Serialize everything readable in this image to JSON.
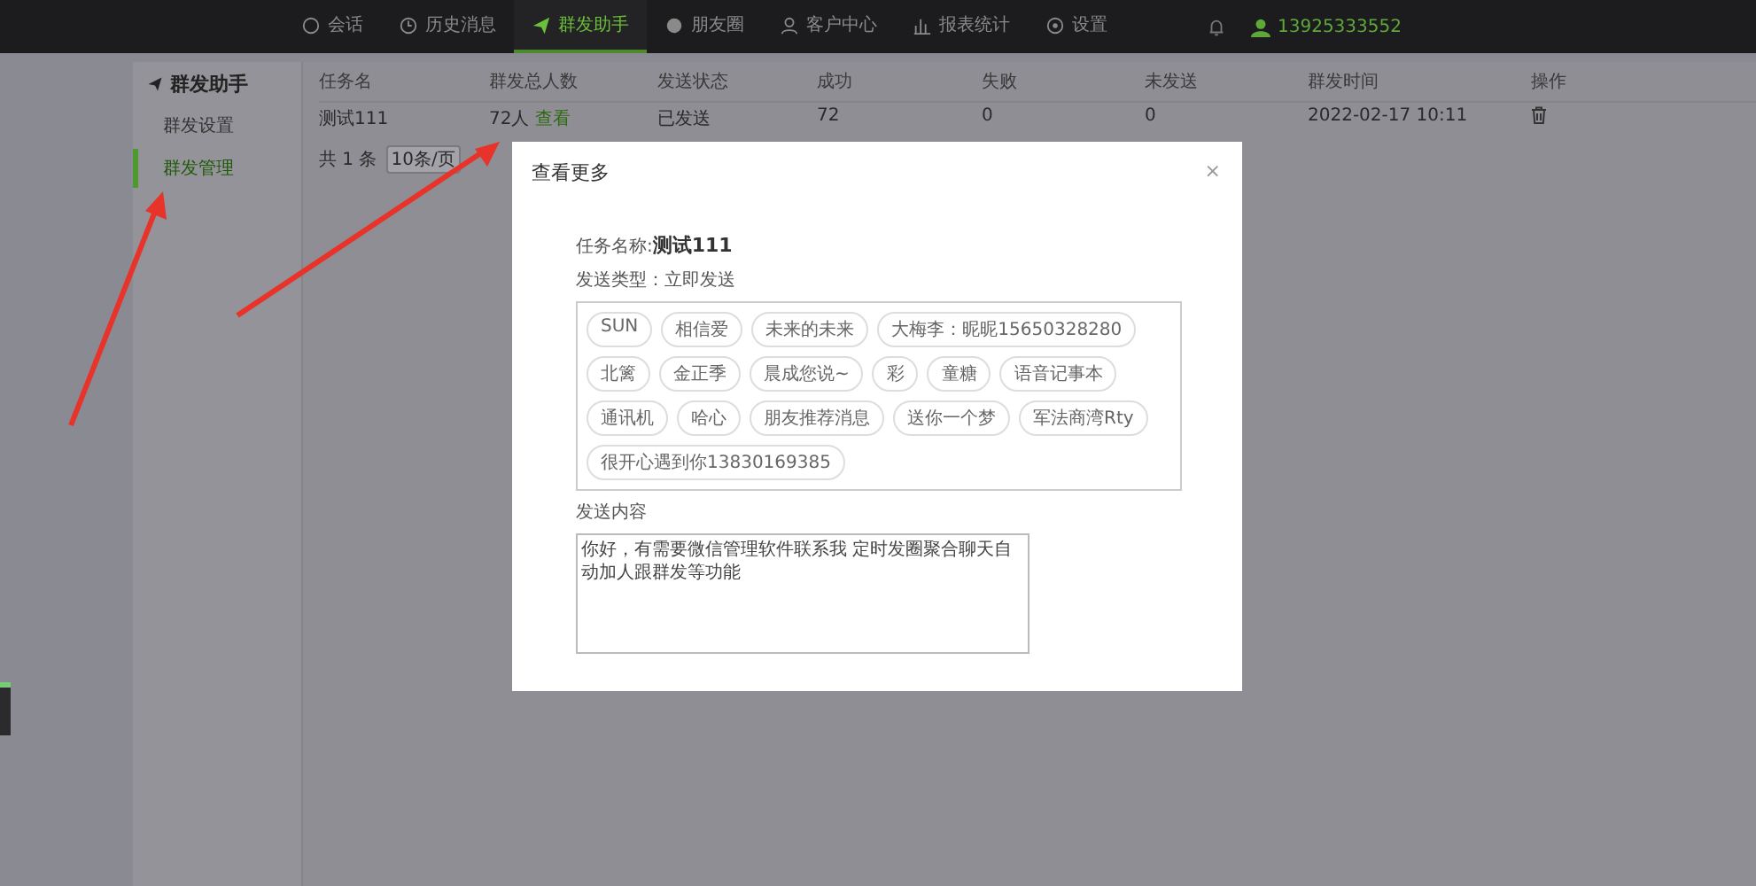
{
  "nav": {
    "items": [
      {
        "label": "会话",
        "selected": false
      },
      {
        "label": "历史消息",
        "selected": false
      },
      {
        "label": "群发助手",
        "selected": true
      },
      {
        "label": "朋友圈",
        "selected": false
      },
      {
        "label": "客户中心",
        "selected": false
      },
      {
        "label": "报表统计",
        "selected": false
      },
      {
        "label": "设置",
        "selected": false
      }
    ],
    "user": "13925333552"
  },
  "sidebar": {
    "title": "群发助手",
    "items": [
      {
        "label": "群发设置",
        "selected": false
      },
      {
        "label": "群发管理",
        "selected": true
      }
    ]
  },
  "table": {
    "columns": [
      "任务名",
      "群发总人数",
      "发送状态",
      "成功",
      "失败",
      "未发送",
      "群发时间",
      "操作"
    ],
    "rows": [
      {
        "name": "测试111",
        "count": "72人",
        "view_link": "查看",
        "status": "已发送",
        "success": "72",
        "failed": "0",
        "unsent": "0",
        "time": "2022-02-17 10:11"
      }
    ]
  },
  "pagination": {
    "total": "共 1 条",
    "page_size": "10条/页"
  },
  "modal": {
    "title": "查看更多",
    "close": "×",
    "task_label": "任务名称:",
    "task_name": "测试111",
    "send_type": "发送类型：立即发送",
    "recipients": [
      "SUN",
      "相信爱",
      "未来的未来",
      "大梅李：昵昵15650328280",
      "北篱",
      "金正季",
      "晨成您说~",
      "彩",
      "童糖",
      "语音记事本",
      "通讯机",
      "哈心",
      "朋友推荐消息",
      "送你一个梦",
      "军法商湾Rty",
      "很开心遇到你13830169385"
    ],
    "content_label": "发送内容",
    "content": "你好，有需要微信管理软件联系我 定时发圈聚合聊天自动加人跟群发等功能"
  }
}
